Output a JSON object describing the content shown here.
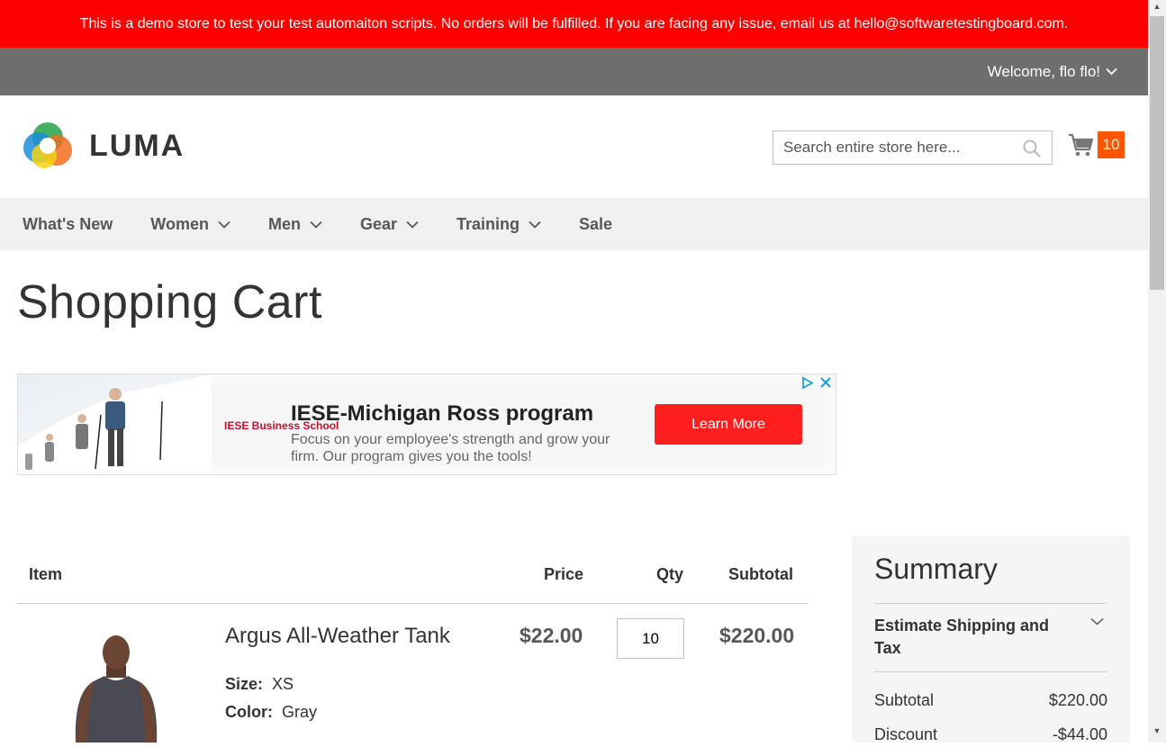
{
  "demo_notice": "This is a demo store to test your test automaiton scripts. No orders will be fulfilled. If you are facing any issue, email us at hello@softwaretestingboard.com.",
  "header": {
    "welcome": "Welcome, flo flo!",
    "logo_text": "LUMA",
    "search_placeholder": "Search entire store here...",
    "cart_count": "10"
  },
  "nav": {
    "items": [
      {
        "label": "What's New"
      },
      {
        "label": "Women"
      },
      {
        "label": "Men"
      },
      {
        "label": "Gear"
      },
      {
        "label": "Training"
      },
      {
        "label": "Sale"
      }
    ]
  },
  "page_title": "Shopping Cart",
  "ad": {
    "brand": "IESE Business School",
    "title": "IESE-Michigan Ross program",
    "description": "Focus on your employee's strength and grow your firm. Our program gives you the tools!",
    "button": "Learn More"
  },
  "cart_table": {
    "headers": {
      "item": "Item",
      "price": "Price",
      "qty": "Qty",
      "subtotal": "Subtotal"
    },
    "rows": [
      {
        "name": "Argus All-Weather Tank",
        "size_label": "Size:",
        "size": "XS",
        "color_label": "Color:",
        "color": "Gray",
        "price": "$22.00",
        "qty": "10",
        "subtotal": "$220.00"
      }
    ]
  },
  "summary": {
    "title": "Summary",
    "estimate": "Estimate Shipping and Tax",
    "subtotal_label": "Subtotal",
    "subtotal": "$220.00",
    "discount_label": "Discount",
    "discount": "-$44.00"
  },
  "colors": {
    "demo_bar": "#ff0000",
    "cart_badge": "#ff5501",
    "ad_button": "#ff1f1f"
  }
}
